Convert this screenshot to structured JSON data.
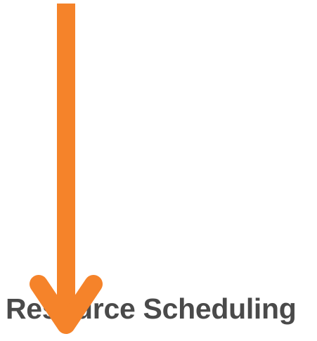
{
  "page": {
    "heading": "Resource Scheduling"
  },
  "colors": {
    "arrow": "#F5832A",
    "heading_text": "#4A4A4A",
    "background": "#FFFFFF"
  },
  "annotation": {
    "type": "arrow",
    "direction": "down",
    "icon": "down-arrow-icon"
  }
}
